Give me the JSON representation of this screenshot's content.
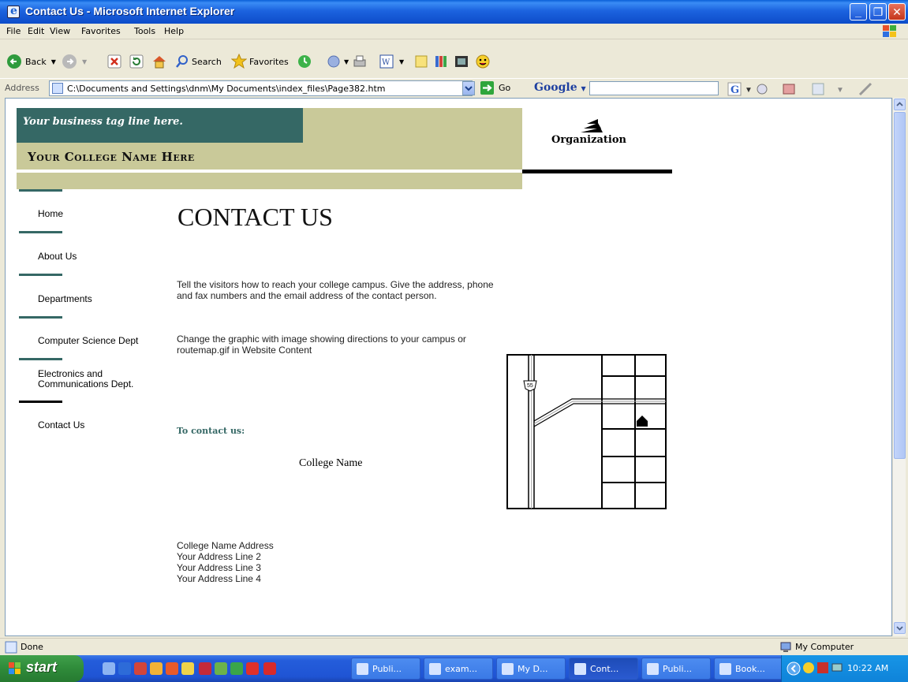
{
  "window": {
    "title": "Contact Us - Microsoft Internet Explorer",
    "minimize_glyph": "_",
    "maximize_glyph": "❐",
    "close_glyph": "✕"
  },
  "menu": [
    "File",
    "Edit",
    "View",
    "Favorites",
    "Tools",
    "Help"
  ],
  "toolbar": {
    "back_label": "Back",
    "search_label": "Search",
    "favorites_label": "Favorites"
  },
  "address_bar": {
    "label": "Address",
    "url": "C:\\Documents and Settings\\dnm\\My Documents\\index_files\\Page382.htm",
    "go_label": "Go",
    "google_label": "Google",
    "google_value": ""
  },
  "page": {
    "tagline": "Your business tag line here.",
    "college_name": "Your College Name Here",
    "org_name": "Organization",
    "nav": [
      {
        "label": "Home",
        "current": false
      },
      {
        "label": "About Us",
        "current": false
      },
      {
        "label": "Departments",
        "current": false
      },
      {
        "label": "Computer Science Dept",
        "current": false
      },
      {
        "label": "Electronics and Communications Dept.",
        "current": false
      },
      {
        "label": "Contact Us",
        "current": true
      }
    ],
    "heading": "CONTACT US",
    "paragraph_1": "Tell the visitors how to reach your college campus. Give the address, phone and fax numbers and the email address of the contact person.",
    "paragraph_2": "Change the graphic with image showing directions to your campus or routemap.gif in Website Content",
    "contact_label": "To contact us:",
    "contact_college_name": "College Name",
    "address_lines": [
      "College Name Address",
      "Your Address Line 2",
      "Your Address Line 3",
      "Your Address Line 4"
    ],
    "map_route_number": "55"
  },
  "status_bar": {
    "status": "Done",
    "zone": "My Computer"
  },
  "taskbar": {
    "start_label": "start",
    "tasks": [
      {
        "label": "Publi...",
        "active": false
      },
      {
        "label": "exam...",
        "active": false
      },
      {
        "label": "My D...",
        "active": false
      },
      {
        "label": "Cont...",
        "active": true
      },
      {
        "label": "Publi...",
        "active": false
      },
      {
        "label": "Book...",
        "active": false
      }
    ],
    "clock": "10:22 AM"
  },
  "colors": {
    "banner_bg": "#c9c999",
    "tagline_bg": "#356865",
    "nav_rule": "#356865",
    "contact_label": "#356865"
  }
}
